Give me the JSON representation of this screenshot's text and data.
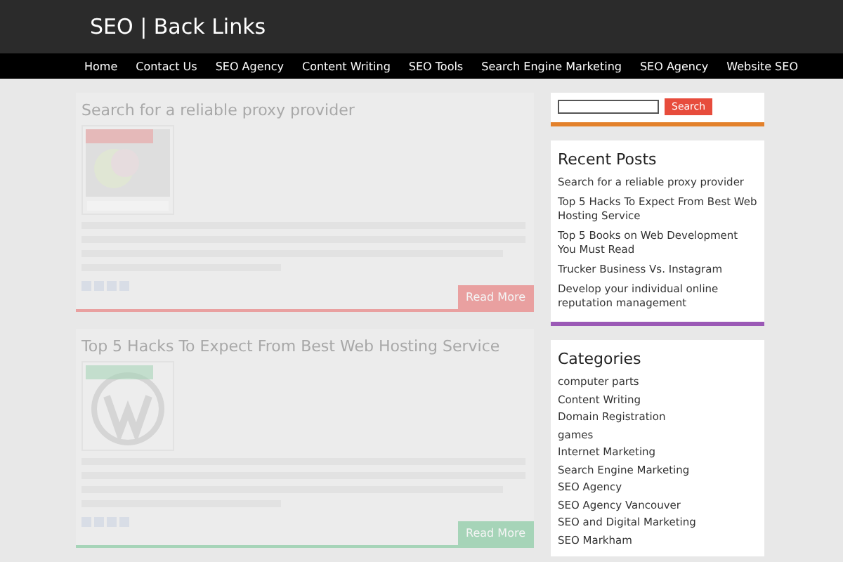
{
  "site": {
    "title": "SEO | Back Links"
  },
  "nav": [
    "Home",
    "Contact Us",
    "SEO Agency",
    "Content Writing",
    "SEO Tools",
    "Search Engine Marketing",
    "SEO Agency",
    "Website SEO"
  ],
  "posts": [
    {
      "title": "Search for a reliable proxy provider",
      "color": "#e9a0a0",
      "read_more": "Read More"
    },
    {
      "title": "Top 5 Hacks To Expect From Best Web Hosting Service",
      "color": "#a6d4b8",
      "read_more": "Read More"
    }
  ],
  "sidebar": {
    "search": {
      "button": "Search"
    },
    "recent_posts": {
      "title": "Recent Posts",
      "items": [
        "Search for a reliable proxy provider",
        "Top 5 Hacks To Expect From Best Web Hosting Service",
        "Top 5 Books on Web Development You Must Read",
        "Trucker Business Vs. Instagram",
        "Develop your individual online reputation management"
      ]
    },
    "categories": {
      "title": "Categories",
      "items": [
        "computer parts",
        "Content Writing",
        "Domain Registration",
        "games",
        "Internet Marketing",
        "Search Engine Marketing",
        "SEO Agency",
        "SEO Agency Vancouver",
        "SEO and Digital Marketing",
        "SEO Markham"
      ]
    }
  }
}
